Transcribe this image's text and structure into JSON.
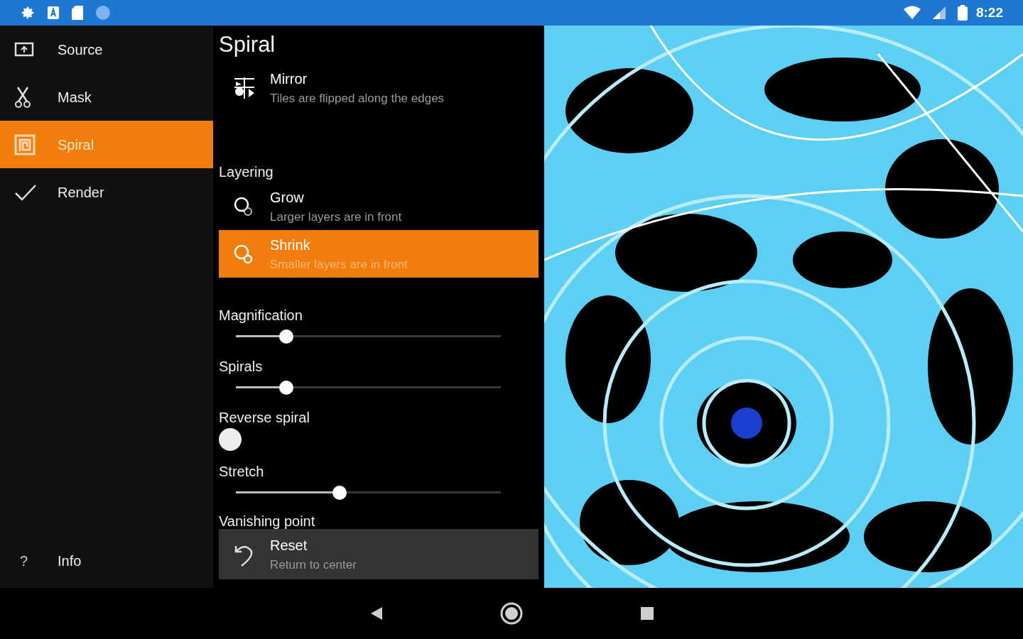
{
  "status_bar": {
    "time": "8:22"
  },
  "sidebar": {
    "items": [
      {
        "label": "Source",
        "selected": false
      },
      {
        "label": "Mask",
        "selected": false
      },
      {
        "label": "Spiral",
        "selected": true
      },
      {
        "label": "Render",
        "selected": false
      }
    ],
    "footer": {
      "icon_glyph": "?",
      "label": "Info"
    }
  },
  "panel": {
    "title": "Spiral",
    "rows": [
      {
        "kind": "option",
        "title": "Mirror",
        "subtitle": "Tiles are flipped along the edges",
        "selected": false
      },
      {
        "kind": "header",
        "label": "Layering"
      },
      {
        "kind": "option",
        "title": "Grow",
        "subtitle": "Larger layers are in front",
        "selected": false
      },
      {
        "kind": "option",
        "title": "Shrink",
        "subtitle": "Smaller layers are in front",
        "selected": true
      },
      {
        "kind": "slider",
        "label": "Magnification",
        "level": 0.17
      },
      {
        "kind": "slider",
        "label": "Spirals",
        "level": 0.17
      },
      {
        "kind": "switch",
        "label": "Reverse spiral",
        "on": false
      },
      {
        "kind": "slider",
        "label": "Stretch",
        "level": 0.38
      },
      {
        "kind": "header",
        "label": "Vanishing point"
      },
      {
        "kind": "action",
        "title": "Reset",
        "subtitle": "Return to center"
      }
    ]
  }
}
